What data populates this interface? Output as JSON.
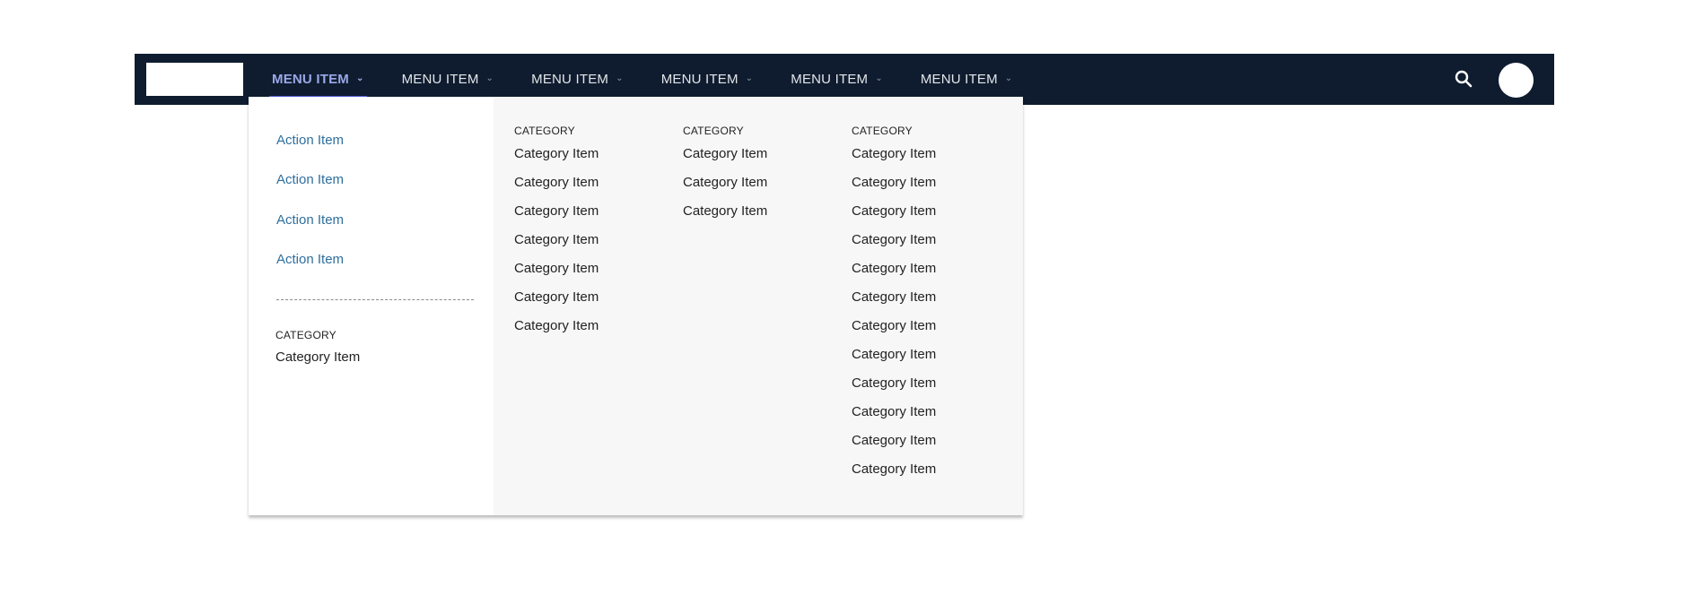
{
  "navbar": {
    "menu": [
      {
        "label": "MENU ITEM",
        "active": true
      },
      {
        "label": "MENU ITEM",
        "active": false
      },
      {
        "label": "MENU ITEM",
        "active": false
      },
      {
        "label": "MENU ITEM",
        "active": false
      },
      {
        "label": "MENU ITEM",
        "active": false
      },
      {
        "label": "MENU ITEM",
        "active": false
      }
    ],
    "chevron": "⌄",
    "search_icon": "search-icon"
  },
  "dropdown": {
    "actions": [
      "Action Item",
      "Action Item",
      "Action Item",
      "Action Item"
    ],
    "left_category": {
      "header": "CATEGORY",
      "items": [
        "Category Item"
      ]
    },
    "columns": [
      {
        "header": "CATEGORY",
        "items": [
          "Category Item",
          "Category Item",
          "Category Item",
          "Category Item",
          "Category Item",
          "Category Item",
          "Category Item"
        ]
      },
      {
        "header": "CATEGORY",
        "items": [
          "Category Item",
          "Category Item",
          "Category Item"
        ]
      },
      {
        "header": "CATEGORY",
        "items": [
          "Category Item",
          "Category Item",
          "Category Item",
          "Category Item",
          "Category Item",
          "Category Item",
          "Category Item",
          "Category Item",
          "Category Item",
          "Category Item",
          "Category Item",
          "Category Item"
        ]
      }
    ]
  },
  "colors": {
    "navbar": "#0f1c2f",
    "active": "#9aa8e8",
    "underline": "#4b5bd1",
    "action": "#2f6f9e"
  }
}
